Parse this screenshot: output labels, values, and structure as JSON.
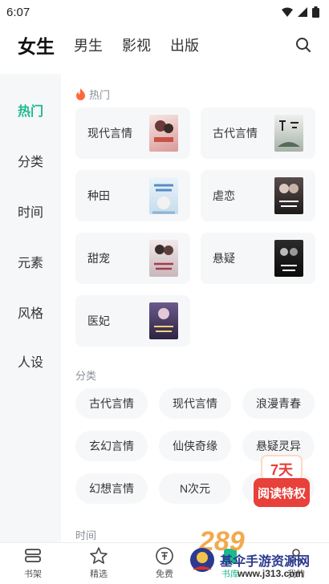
{
  "status": {
    "time": "6:07"
  },
  "top_tabs": [
    "女生",
    "男生",
    "影视",
    "出版"
  ],
  "side_nav": [
    "热门",
    "分类",
    "时间",
    "元素",
    "风格",
    "人设"
  ],
  "sections": {
    "hot_title": "热门",
    "category_title": "分类",
    "time_title": "时间"
  },
  "hot_cards": [
    {
      "label": "现代言情",
      "cover_text": "时光微暖",
      "cover_color": "#f0d8d6"
    },
    {
      "label": "古代言情",
      "cover_text": "长安",
      "cover_color": "#dfe3e2"
    },
    {
      "label": "种田",
      "cover_text": "农家",
      "cover_color": "#dce9f5"
    },
    {
      "label": "虐恋",
      "cover_text": "夫人",
      "cover_color": "#3a3434"
    },
    {
      "label": "甜宠",
      "cover_text": "甜宠",
      "cover_color": "#e9dfe0"
    },
    {
      "label": "悬疑",
      "cover_text": "诡秘",
      "cover_color": "#1f1f1f"
    },
    {
      "label": "医妃",
      "cover_text": "医妃",
      "cover_color": "#5a4a7a"
    }
  ],
  "category_chips": [
    "古代言情",
    "现代言情",
    "浪漫青春",
    "玄幻言情",
    "仙侠奇缘",
    "悬疑灵异",
    "幻想言情",
    "N次元"
  ],
  "promo": {
    "top": "7天",
    "bottom": "阅读特权"
  },
  "bottom_nav": [
    {
      "label": "书架",
      "icon": "bookshelf-icon"
    },
    {
      "label": "精选",
      "icon": "star-icon"
    },
    {
      "label": "免费",
      "icon": "free-icon"
    },
    {
      "label": "书库",
      "icon": "library-icon"
    },
    {
      "label": "我的",
      "icon": "profile-icon"
    }
  ],
  "watermark": {
    "title": "基伞手游资源网",
    "url": "www.j313.com",
    "logo": "289"
  },
  "colors": {
    "accent": "#1bb98f",
    "card_bg": "#f6f7f9",
    "promo_red": "#e8403a"
  }
}
